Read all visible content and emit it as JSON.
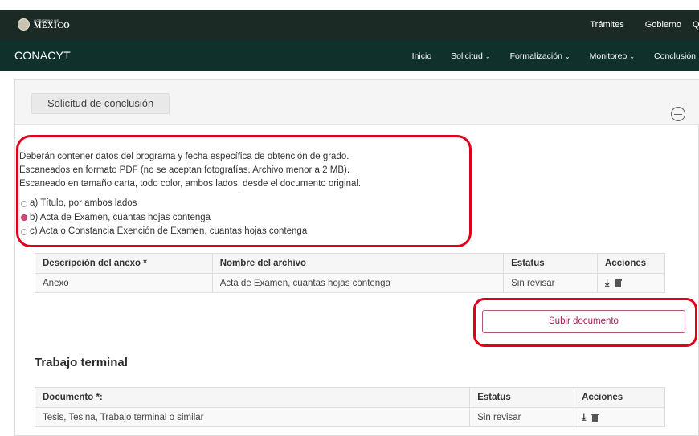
{
  "gov_header": {
    "logo_small": "GOBIERNO DE",
    "logo_big": "MÉXICO",
    "links": [
      "Trámites",
      "Gobierno"
    ],
    "extra_glyph": "Q"
  },
  "nav": {
    "brand": "CONACYT",
    "items": [
      {
        "label": "Inicio",
        "caret": ""
      },
      {
        "label": "Solicitud",
        "caret": "⌄"
      },
      {
        "label": "Formalización",
        "caret": "⌄"
      },
      {
        "label": "Monitoreo",
        "caret": "⌄"
      },
      {
        "label": "Conclusión",
        "caret": ""
      }
    ]
  },
  "panel": {
    "title": "Solicitud de conclusión",
    "instructions": [
      "Deberán contener datos del programa y fecha específica de obtención de grado.",
      "Escaneados en formato PDF (no se aceptan fotografías. Archivo menor a 2 MB).",
      "Escaneado en tamaño carta, todo color, ambos lados, desde el documento original."
    ],
    "options": [
      {
        "label": "a) Título, por ambos lados",
        "checked": false
      },
      {
        "label": "b) Acta de Examen, cuantas hojas contenga",
        "checked": true
      },
      {
        "label": "c) Acta o Constancia Exención de Examen, cuantas hojas contenga",
        "checked": false
      }
    ]
  },
  "annex_table": {
    "headers": [
      "Descripción del anexo *",
      "Nombre del archivo",
      "Estatus",
      "Acciones"
    ],
    "rows": [
      {
        "description": "Anexo",
        "file": "Acta de Examen, cuantas hojas contenga",
        "status": "Sin revisar"
      }
    ]
  },
  "upload_button": "Subir documento",
  "trabajo": {
    "title": "Trabajo terminal",
    "headers": [
      "Documento *:",
      "Estatus",
      "Acciones"
    ],
    "rows": [
      {
        "document": "Tesis, Tesina, Trabajo terminal o similar",
        "status": "Sin revisar"
      }
    ]
  },
  "icons": {
    "download": "download-icon",
    "delete": "trash-icon",
    "collapse": "minus-circle-icon"
  },
  "colors": {
    "gov_bar": "#1b2a25",
    "nav_bar": "#10312b",
    "accent": "#9d2449",
    "highlight": "#e0001a"
  }
}
